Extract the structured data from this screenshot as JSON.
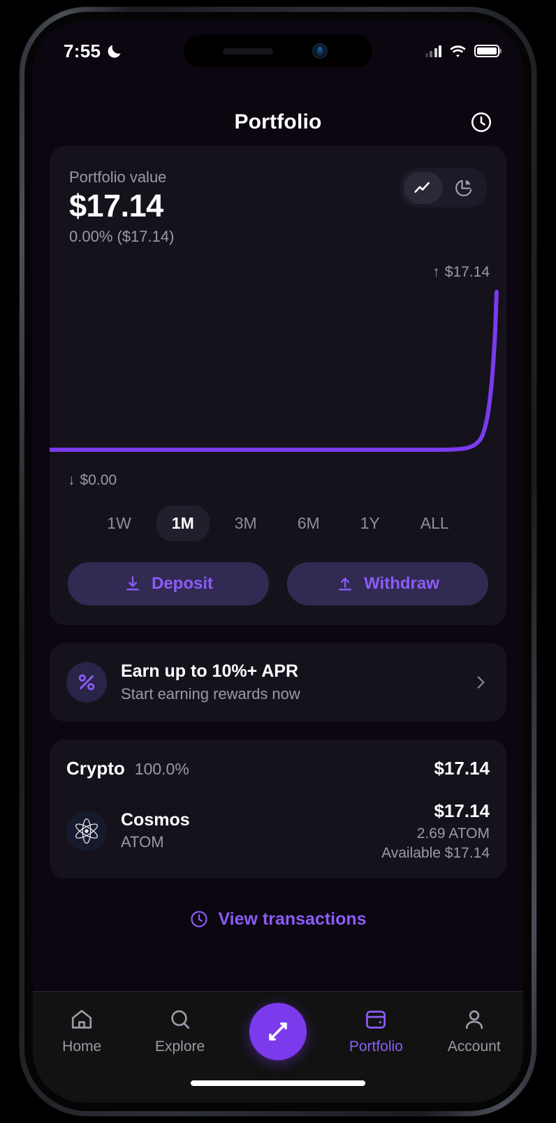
{
  "status_bar": {
    "time": "7:55",
    "dnd_icon": "crescent-moon-icon",
    "signal_icon": "cellular-signal-icon",
    "wifi_icon": "wifi-icon",
    "battery_icon": "battery-full-icon"
  },
  "header": {
    "title": "Portfolio",
    "action_icon": "clock-history-icon"
  },
  "portfolio_card": {
    "label": "Portfolio value",
    "value": "$17.14",
    "change": "0.00% ($17.14)",
    "chart_toggle": [
      {
        "id": "line",
        "icon": "line-chart-icon",
        "active": true
      },
      {
        "id": "pie",
        "icon": "pie-chart-icon",
        "active": false
      }
    ],
    "chart_high": "$17.14",
    "chart_low": "$0.00",
    "high_arrow": "↑",
    "low_arrow": "↓",
    "ranges": [
      {
        "label": "1W",
        "active": false
      },
      {
        "label": "1M",
        "active": true
      },
      {
        "label": "3M",
        "active": false
      },
      {
        "label": "6M",
        "active": false
      },
      {
        "label": "1Y",
        "active": false
      },
      {
        "label": "ALL",
        "active": false
      }
    ],
    "deposit_label": "Deposit",
    "withdraw_label": "Withdraw",
    "deposit_icon": "download-arrow-icon",
    "withdraw_icon": "upload-arrow-icon"
  },
  "apr_banner": {
    "icon": "percent-icon",
    "title": "Earn up to 10%+ APR",
    "subtitle": "Start earning rewards now",
    "chevron_icon": "chevron-right-icon"
  },
  "holdings": {
    "category": "Crypto",
    "percent": "100.0%",
    "total": "$17.14",
    "assets": [
      {
        "logo_icon": "cosmos-atom-icon",
        "name": "Cosmos",
        "symbol": "ATOM",
        "fiat": "$17.14",
        "quantity": "2.69 ATOM",
        "available": "Available $17.14"
      }
    ]
  },
  "view_transactions": {
    "label": "View transactions",
    "icon": "clock-icon"
  },
  "tabbar": [
    {
      "label": "Home",
      "icon": "home-icon",
      "active": false
    },
    {
      "label": "Explore",
      "icon": "search-icon",
      "active": false
    },
    {
      "label": "",
      "icon": "swap-icon",
      "active": false,
      "fab": true
    },
    {
      "label": "Portfolio",
      "icon": "wallet-icon",
      "active": true
    },
    {
      "label": "Account",
      "icon": "person-icon",
      "active": false
    }
  ],
  "colors": {
    "accent": "#8b5cf6",
    "fab": "#7c3aed",
    "screen_bg": "#0b0610",
    "card_bg": "#15121c",
    "muted_text": "#9b9aa7"
  },
  "chart_data": {
    "type": "line",
    "title": "Portfolio value",
    "xlabel": "",
    "ylabel": "",
    "ylim": [
      0,
      17.14
    ],
    "grid": false,
    "legend": false,
    "annotations": [
      {
        "text": "↑ $17.14",
        "position": "top-right"
      },
      {
        "text": "↓ $0.00",
        "position": "bottom-left"
      }
    ],
    "series": [
      {
        "name": "Portfolio value",
        "color": "#7c3aed",
        "x": [
          0,
          10,
          20,
          30,
          40,
          50,
          60,
          70,
          80,
          85,
          90,
          93,
          95,
          96,
          97,
          98,
          99,
          100
        ],
        "values": [
          0,
          0,
          0,
          0,
          0,
          0,
          0,
          0,
          0,
          0,
          0,
          0.05,
          0.3,
          1.2,
          3.5,
          8.0,
          13.5,
          17.14
        ]
      }
    ]
  }
}
